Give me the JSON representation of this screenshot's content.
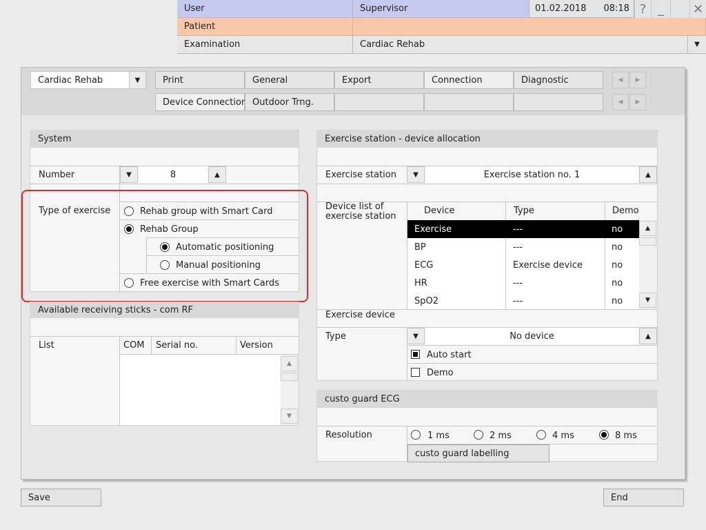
{
  "header": {
    "user_label": "User",
    "user_value": "Supervisor",
    "date": "01.02.2018",
    "time": "08:18",
    "patient_label": "Patient",
    "patient_value": "",
    "examination_label": "Examination",
    "examination_value": "Cardiac Rehab",
    "help_glyph": "?",
    "minimize_glyph": "_",
    "close_glyph": "✕"
  },
  "toolbar": {
    "program_select": "Cardiac Rehab",
    "tabs_row1": [
      "Print",
      "General",
      "Export",
      "Connection",
      "Diagnostic"
    ],
    "tabs_row2": [
      "Device Connection",
      "Outdoor Trng.",
      "",
      "",
      ""
    ],
    "active_tab": "Connection",
    "active_subtab": "Device Connection"
  },
  "system": {
    "title": "System",
    "number_label": "Number",
    "number_value": "8",
    "type_label": "Type of exercise",
    "options": [
      "Rehab group with Smart Card",
      "Rehab Group",
      "Automatic positioning",
      "Manual positioning",
      "Free exercise with Smart Cards"
    ],
    "selected": [
      "Rehab Group",
      "Automatic positioning"
    ]
  },
  "sticks": {
    "title": "Available receiving sticks - com RF",
    "list_label": "List",
    "columns": [
      "COM",
      "Serial no.",
      "Version"
    ],
    "rows": []
  },
  "allocation": {
    "title": "Exercise station - device allocation",
    "station_label": "Exercise station",
    "station_value": "Exercise station no. 1",
    "device_list_label": "Device list of exercise station",
    "columns": [
      "Device",
      "Type",
      "Demo"
    ],
    "rows": [
      {
        "device": "Exercise",
        "type": "---",
        "demo": "no",
        "selected": true
      },
      {
        "device": "BP",
        "type": "---",
        "demo": "no"
      },
      {
        "device": "ECG",
        "type": "Exercise device",
        "demo": "no"
      },
      {
        "device": "HR",
        "type": "---",
        "demo": "no"
      },
      {
        "device": "SpO2",
        "type": "---",
        "demo": "no"
      }
    ],
    "exercise_device_label": "Exercise device",
    "type_label": "Type",
    "type_value": "No device",
    "auto_start_label": "Auto start",
    "auto_start_checked": true,
    "demo_label": "Demo",
    "demo_checked": false
  },
  "ecg": {
    "title": "custo guard ECG",
    "resolution_label": "Resolution",
    "options": [
      "1 ms",
      "2 ms",
      "4 ms",
      "8 ms"
    ],
    "selected": "8 ms",
    "labelling_button": "custo guard labelling"
  },
  "footer": {
    "save_label": "Save",
    "end_label": "End"
  },
  "colors": {
    "user_bar": "#c6c9ee",
    "patient_bar": "#f8c8aa",
    "highlight": "#e02a2a",
    "selected_row": "#000000"
  }
}
